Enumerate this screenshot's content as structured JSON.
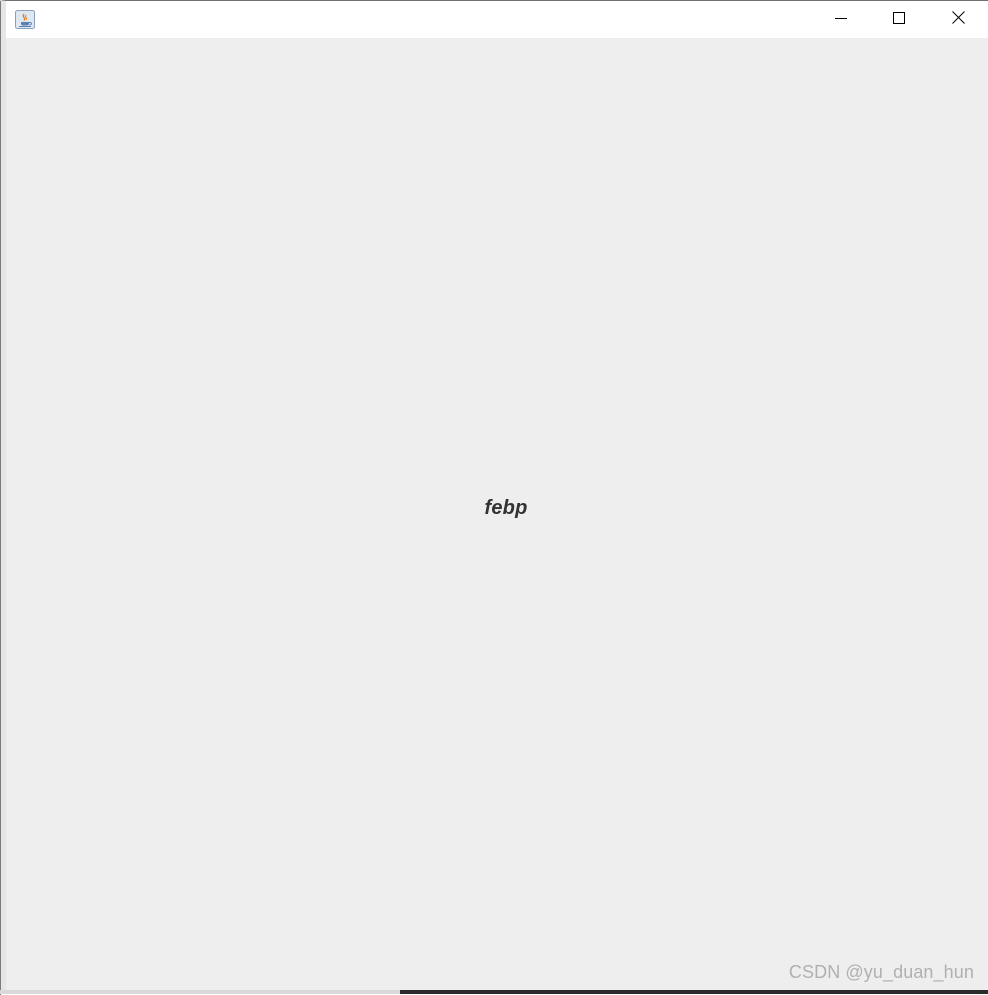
{
  "window": {
    "app_icon": "java-coffee-cup-icon",
    "controls": {
      "minimize_icon": "minimize-icon",
      "maximize_icon": "maximize-icon",
      "close_icon": "close-icon"
    }
  },
  "content": {
    "label_text": "febp",
    "label_color": "#333333",
    "background_color": "#eeeeee"
  },
  "watermark": {
    "text": "CSDN @yu_duan_hun"
  }
}
